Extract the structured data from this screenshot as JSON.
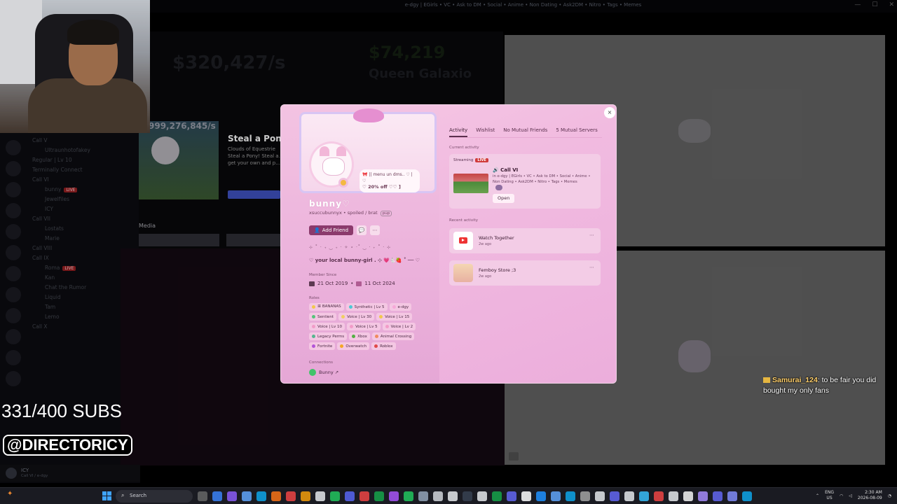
{
  "window": {
    "title": "e-dgy | EGirls • VC • Ask to DM • Social • Anime • Non Dating • Ask2DM • Nitro • Tags • Memes"
  },
  "background": {
    "stream_counter": "$320,427/s",
    "stream_counter2": "$74,219",
    "stream_name": "Queen Galaxio",
    "game_stat": "999,276,845/s",
    "game_title": "Steal a Ponys",
    "game_subtitle": "Clouds of Equestrie",
    "game_desc": "Steal a Pony! Steal a... Or get your own and p...",
    "media_label": "Media",
    "channels": [
      {
        "text": "Call V",
        "type": "channel"
      },
      {
        "text": "Ultraunhotofakey",
        "type": "user"
      },
      {
        "text": "Regular | Lv 10",
        "type": "channel"
      },
      {
        "text": "Terminally Connect",
        "type": "channel"
      },
      {
        "text": "Call VI",
        "type": "channel"
      },
      {
        "text": "bunny",
        "type": "user",
        "live": "LIVE"
      },
      {
        "text": "Jewelfiles",
        "type": "user"
      },
      {
        "text": "ICY",
        "type": "user"
      },
      {
        "text": "Call VII",
        "type": "channel"
      },
      {
        "text": "Lostats",
        "type": "user"
      },
      {
        "text": "Marie",
        "type": "user"
      },
      {
        "text": "Call VIII",
        "type": "channel"
      },
      {
        "text": "Call IX",
        "type": "channel"
      },
      {
        "text": "Roma",
        "type": "user",
        "live": "LIVE"
      },
      {
        "text": "Kan",
        "type": "user"
      },
      {
        "text": "Chat the Rumor",
        "type": "user"
      },
      {
        "text": "Liquid",
        "type": "user"
      },
      {
        "text": "Tam",
        "type": "user"
      },
      {
        "text": "Lemo",
        "type": "user"
      },
      {
        "text": "Call X",
        "type": "channel"
      }
    ],
    "user_panel": {
      "name": "ICY",
      "status": "Call VI / e-dgy"
    }
  },
  "overlay": {
    "subs": "331/400 SUBS",
    "handle": "@DIRECTORICY",
    "chat": {
      "user": "Samurai_124",
      "message": ": to be fair you did bought my only fans"
    }
  },
  "profile": {
    "close_icon": "×",
    "display_name": "bunny♡",
    "username": "xsuccubunnyx",
    "pronouns": "spoiled / brat",
    "tag": "pup",
    "status_bubble": {
      "line1": "🎀 || menu un dms.. ♡ | ♡",
      "line2": "♡ 20% off ♡♡ ]"
    },
    "buttons": {
      "add_friend": "Add Friend",
      "message_icon": "💬",
      "more_icon": "⋯"
    },
    "deco_line": "⊹ ˚ · ₊ ‿ ₊ · ✧ ⋆ ·˚ ‿ · ₊ ˚ · ⊹",
    "bio": "♡ your local bunny-girl . ⊹ 💗🐇🍓 ˚ ── ♡",
    "member_since_label": "Member Since",
    "member_since_discord": "21 Oct 2019",
    "member_since_server": "11 Oct 2024",
    "roles_label": "Roles",
    "roles": [
      [
        {
          "name": "ꕥ BANANAS",
          "color": "#f2c84b"
        },
        {
          "name": "Synthetic | Lv 5",
          "color": "#4cc9d4"
        },
        {
          "name": "e-dgy",
          "color": "#f7a8d8"
        }
      ],
      [
        {
          "name": "Sentient",
          "color": "#56c47a"
        },
        {
          "name": "Voice | Lv 30",
          "color": "#f0d060"
        },
        {
          "name": "Voice | Lv 15",
          "color": "#f2c84b"
        }
      ],
      [
        {
          "name": "Voice | Lv 10",
          "color": "#f29bc8"
        },
        {
          "name": "Voice | Lv 5",
          "color": "#f29bc8"
        },
        {
          "name": "Voice | Lv 2",
          "color": "#f29bc8"
        }
      ],
      [
        {
          "name": "Legacy Perms",
          "color": "#56b68e"
        },
        {
          "name": "Xbox",
          "color": "#52b043"
        },
        {
          "name": "Animal Crossing",
          "color": "#f08a5d"
        }
      ],
      [
        {
          "name": "Fortnite",
          "color": "#b454d8"
        },
        {
          "name": "Overwatch",
          "color": "#f5a623"
        },
        {
          "name": "Roblox",
          "color": "#e04848"
        }
      ]
    ],
    "connections_label": "Connections",
    "connection": "Bunny ↗",
    "tabs": [
      "Activity",
      "Wishlist",
      "No Mutual Friends",
      "5 Mutual Servers"
    ],
    "current_activity_label": "Current activity",
    "streaming": {
      "label": "Streaming",
      "live": "LIVE",
      "title": "🔊 Call VI",
      "subtitle": "in e-dgy | EGirls • VC • Ask to DM • Social • Anime • Non Dating • Ask2DM • Nitro • Tags • Memes",
      "open": "Open"
    },
    "recent_activity_label": "Recent activity",
    "recent": [
      {
        "title": "Watch Together",
        "time": "2w ago"
      },
      {
        "title": "Femboy Store ;3",
        "time": "2w ago"
      }
    ]
  },
  "taskbar": {
    "search_placeholder": "Search",
    "lang_1": "ENG",
    "lang_2": "US",
    "time": "2:30 AM",
    "date": "2026-08-09"
  }
}
